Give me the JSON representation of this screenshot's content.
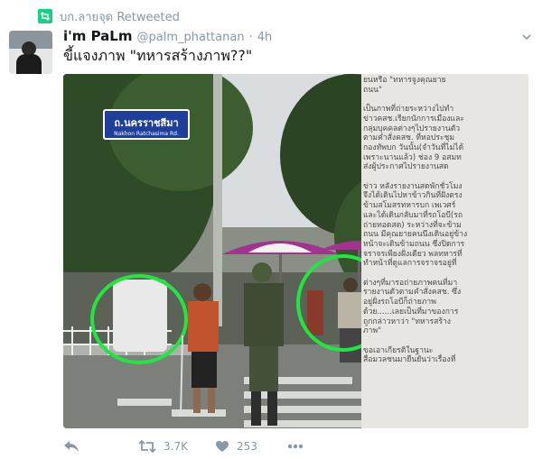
{
  "retweet_label": "บก.ลายจุด Retweeted",
  "tweet": {
    "display_name": "i'm PaLm",
    "handle": "@palm_phattanan",
    "separator": "·",
    "time": "4h",
    "text": "ขี้แจงภาพ \"ทหารสร้างภาพ??\""
  },
  "media": {
    "sign_thai": "ถ.นครราชสีมา",
    "sign_english": "Nakhon Ratchasima Rd.",
    "caption_lines": [
      "ยนหรือ \"ทหารจูงคุณยาย",
      "ถนน\"",
      "",
      "เป็นภาพที่ถ่ายระหว่างไปทำ",
      "ข่าวคสช.เรียกนักการเมืองและ",
      "กลุ่มบุคคลต่างๆไปรายงานตัว",
      "ตามคำสั่งคสช. ที่หอประชุม",
      "กองทัพบก วันนั้น(จำวันที่ไม่ได้",
      "เพราะนานแล้ว) ช่อง 9 อสมท",
      "ส่งผู้ประกาศไปรายงานสด",
      "",
      "ข่าว หลังรายงานสดพักชั่วโมง",
      "จึงได้เดินไปหาข้าวกินที่ฝั่งตรง",
      "ข้ามสโมสรทหารบก เพเวศร์",
      "และได้เดินกลับมาที่รถโอบี(รถ",
      "ถ่ายทอดสด) ระหว่างที่จะข้าม",
      "ถนน มีคุณยายคนนึงเดินอยู่ข้าง",
      "หน้าจะเดินข้ามถนน ซึ่งปิดการ",
      "จราจรเพียงฝั่งเดียว พลทหารที่",
      "ทำหน้าที่ดูแลการจราจรอยู่ที่",
      "",
      "ต่างๆที่มารอถ่ายภาพคนที่มา",
      "รายงานตัวตามคำสั่งคสช. ซึ่ง",
      "อยู่ฝั่งรถโอบีก็ถ่ายภาพ",
      "ด้วย......เลยเป็นที่มาของการ",
      "ถูกกล่าวหาว่า \"ทหารสร้าง",
      "ภาพ\"",
      "",
      "ขอเอาเกียรติในฐานะ",
      "สื่อมวลชนมายืนยันว่าเรื่องที่"
    ]
  },
  "actions": {
    "retweet_count": "3.7K",
    "like_count": "253"
  },
  "colors": {
    "retweet_green": "#19cf86",
    "circle_green": "#22e640",
    "sign_blue": "#1f3f9a",
    "umbrella_purple": "#a2338f"
  }
}
